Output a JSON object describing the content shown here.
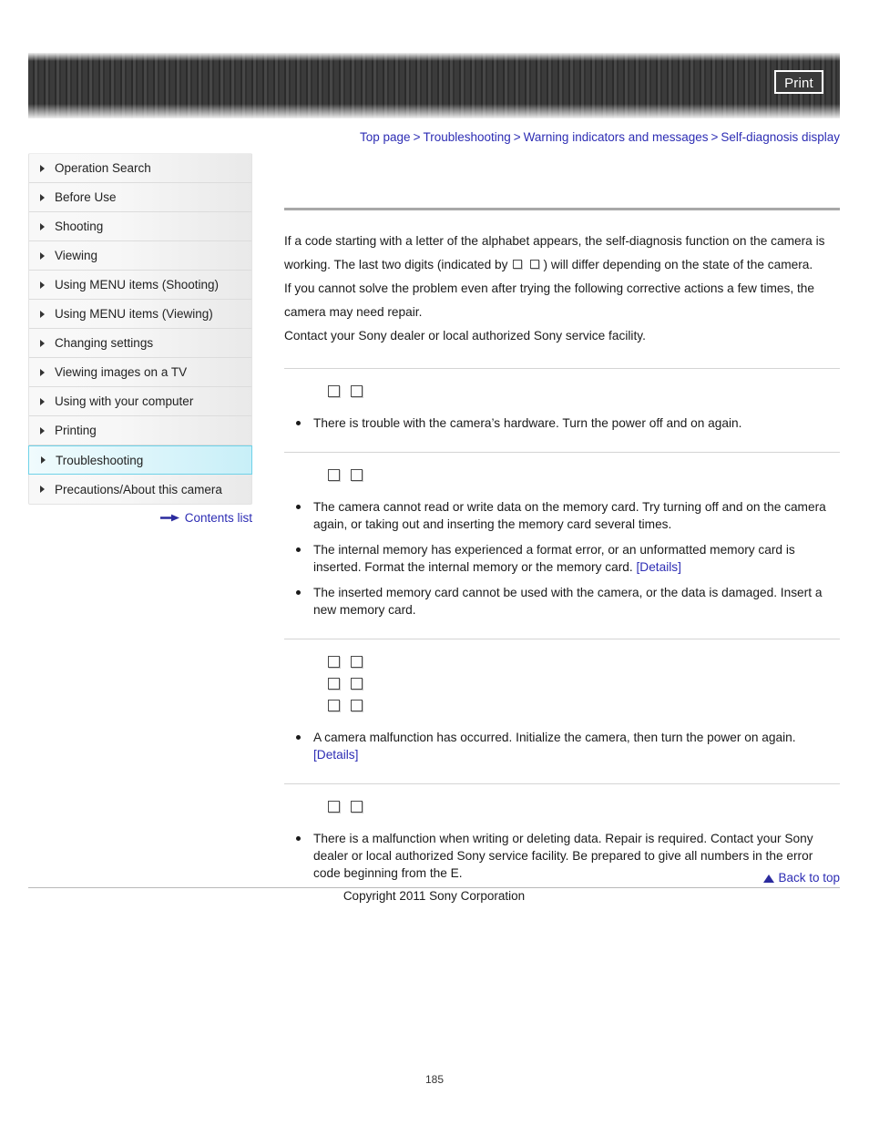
{
  "header": {
    "print_label": "Print"
  },
  "breadcrumb": {
    "separator": ">",
    "items": [
      {
        "label": "Top page"
      },
      {
        "label": "Troubleshooting"
      },
      {
        "label": "Warning indicators and messages"
      },
      {
        "label": "Self-diagnosis display"
      }
    ]
  },
  "sidebar": {
    "items": [
      {
        "label": "Operation Search",
        "active": false
      },
      {
        "label": "Before Use",
        "active": false
      },
      {
        "label": "Shooting",
        "active": false
      },
      {
        "label": "Viewing",
        "active": false
      },
      {
        "label": "Using MENU items (Shooting)",
        "active": false
      },
      {
        "label": "Using MENU items (Viewing)",
        "active": false
      },
      {
        "label": "Changing settings",
        "active": false
      },
      {
        "label": "Viewing images on a TV",
        "active": false
      },
      {
        "label": "Using with your computer",
        "active": false
      },
      {
        "label": "Printing",
        "active": false
      },
      {
        "label": "Troubleshooting",
        "active": true
      },
      {
        "label": "Precautions/About this camera",
        "active": false
      }
    ],
    "contents_link": "Contents list"
  },
  "main": {
    "intro": {
      "part1": "If a code starting with a letter of the alphabet appears, the self-diagnosis function on the camera is working. The last two digits (indicated by",
      "part2": ") will differ depending on the state of the camera.",
      "part3": "If you cannot solve the problem even after trying the following corrective actions a few times, the camera may need repair.",
      "part4": "Contact your Sony dealer or local authorized Sony service facility."
    },
    "sections": [
      {
        "code_rows": 1,
        "bullets": [
          {
            "text": "There is trouble with the camera’s hardware. Turn the power off and on again.",
            "link": null,
            "link_inline": false
          }
        ]
      },
      {
        "code_rows": 1,
        "bullets": [
          {
            "text": "The camera cannot read or write data on the memory card. Try turning off and on the camera again, or taking out and inserting the memory card several times.",
            "link": null,
            "link_inline": false
          },
          {
            "text": "The internal memory has experienced a format error, or an unformatted memory card is inserted. Format the internal memory or the memory card.",
            "link": "[Details]",
            "link_inline": true
          },
          {
            "text": "The inserted memory card cannot be used with the camera, or the data is damaged. Insert a new memory card.",
            "link": null,
            "link_inline": false
          }
        ]
      },
      {
        "code_rows": 3,
        "bullets": [
          {
            "text": "A camera malfunction has occurred. Initialize the camera, then turn the power on again.",
            "link": "[Details]",
            "link_inline": false
          }
        ]
      },
      {
        "code_rows": 1,
        "bullets": [
          {
            "text": "There is a malfunction when writing or deleting data. Repair is required. Contact your Sony dealer or local authorized Sony service facility. Be prepared to give all numbers in the error code beginning from the E.",
            "link": null,
            "link_inline": false
          }
        ]
      }
    ]
  },
  "footer": {
    "back_to_top": "Back to top",
    "copyright": "Copyright 2011 Sony Corporation",
    "page_number": "185"
  },
  "colors": {
    "link": "#2d2db4",
    "active_highlight": "#c8eff8",
    "banner": "#3b3b3b"
  }
}
